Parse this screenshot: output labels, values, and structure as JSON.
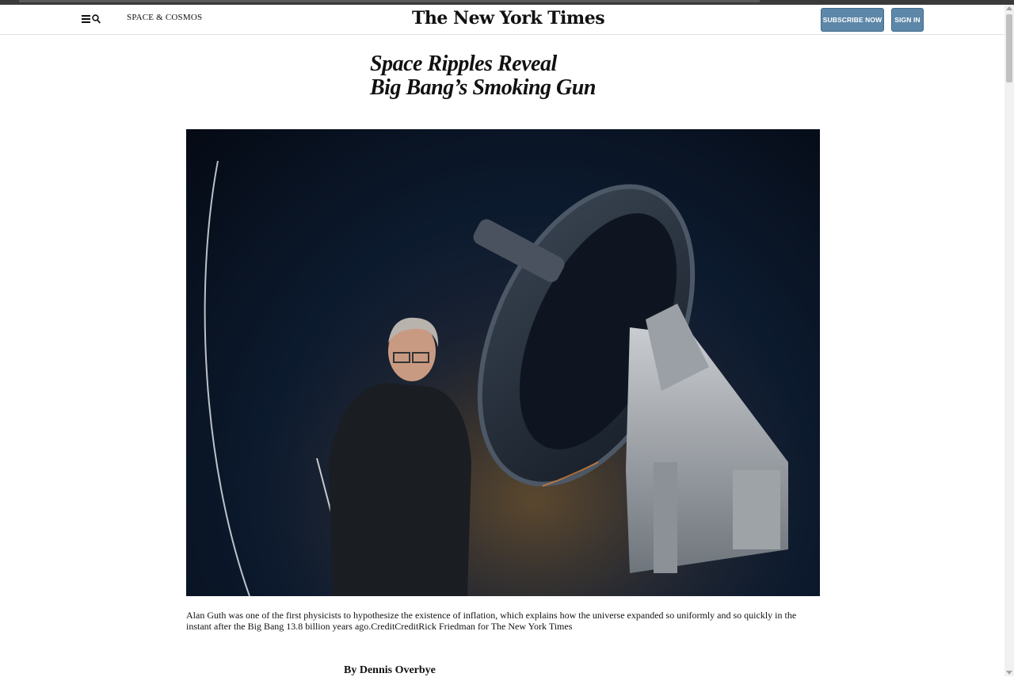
{
  "header": {
    "section_link": "SPACE & COSMOS",
    "logo_text": "The New York Times",
    "subscribe_label": "SUBSCRIBE NOW",
    "signin_label": "SIGN IN",
    "icons": [
      "menu-icon",
      "search-icon"
    ]
  },
  "article": {
    "headline_line1": "Space Ripples Reveal",
    "headline_line2": "Big Bang’s Smoking Gun",
    "photo_description_icon": "telescope-portrait-photo",
    "caption": "Alan Guth was one of the first physicists to hypothesize the existence of inflation, which explains how the universe expanded so uniformly and so quickly in the instant after the Big Bang 13.8 billion years ago.CreditCreditRick Friedman for The New York Times",
    "byline": "By Dennis Overbye"
  },
  "colors": {
    "button_bg": "#5d87a8",
    "photo_dark": "#0c1a2e"
  }
}
